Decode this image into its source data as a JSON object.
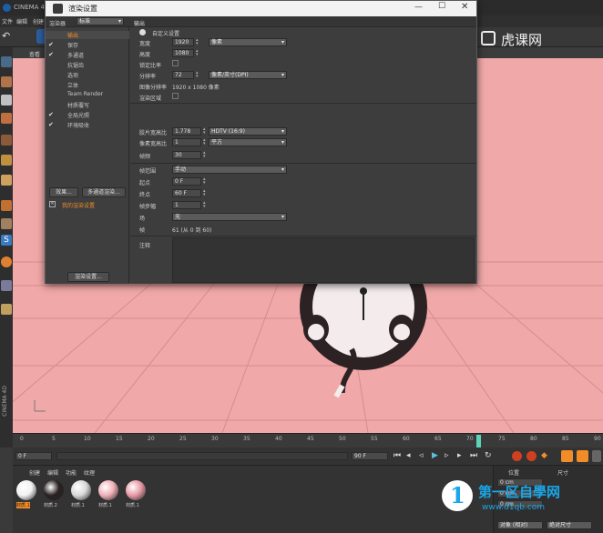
{
  "app": {
    "title": "CINEMA 4D",
    "menu": [
      "文件",
      "编辑",
      "创建"
    ],
    "viewport_menu": [
      "查看"
    ],
    "side_label": "CINEMA 4D"
  },
  "watermark_top": {
    "text": "虎课网"
  },
  "render_settings": {
    "window_title": "渲染设置",
    "renderer_label": "渲染器",
    "renderer_value": "标准",
    "panel_title": "输出",
    "nav": [
      {
        "label": "输出",
        "checked": false,
        "active": true
      },
      {
        "label": "保存",
        "checked": true,
        "active": false
      },
      {
        "label": "多通道",
        "checked": true,
        "active": false
      },
      {
        "label": "抗锯齿",
        "checked": false,
        "active": false
      },
      {
        "label": "选项",
        "checked": false,
        "active": false
      },
      {
        "label": "立体",
        "checked": false,
        "active": false
      },
      {
        "label": "Team Render",
        "checked": false,
        "active": false
      },
      {
        "label": "材质覆写",
        "checked": false,
        "active": false
      },
      {
        "label": "全局光照",
        "checked": true,
        "active": false
      },
      {
        "label": "环境吸收",
        "checked": true,
        "active": false
      }
    ],
    "effect_button": "效果...",
    "multipass_button": "多通道渲染...",
    "preset_item": "我的渲染设置",
    "render_settings_button": "渲染设置...",
    "preset_label": "自定义设置",
    "width_label": "宽度",
    "width_value": "1920",
    "width_unit": "像素",
    "height_label": "高度",
    "height_value": "1080",
    "lock_ratio_label": "锁定比率",
    "lock_ratio_value": "",
    "resolution_label": "分辨率",
    "resolution_value": "72",
    "resolution_unit": "像素/英寸(DPI)",
    "image_res_label": "图像分辨率",
    "image_res_value": "1920 x 1080 像素",
    "render_region_label": "渲染区域",
    "film_aspect_label": "胶片宽高比",
    "film_aspect_value": "1.778",
    "film_aspect_preset": "HDTV (16:9)",
    "pixel_aspect_label": "像素宽高比",
    "pixel_aspect_value": "1",
    "pixel_aspect_preset": "平方",
    "fps_label": "帧频",
    "fps_value": "30",
    "frame_range_label": "帧范围",
    "frame_range_value": "手动",
    "start_label": "起点",
    "start_value": "0 F",
    "end_label": "终点",
    "end_value": "60 F",
    "step_label": "帧步幅",
    "step_value": "1",
    "field_label": "场",
    "field_value": "无",
    "frames_label": "帧",
    "frames_value": "61 (从 0 到 60)",
    "notes_label": "注释"
  },
  "timeline": {
    "ticks": [
      "0",
      "5",
      "10",
      "15",
      "20",
      "25",
      "30",
      "35",
      "40",
      "45",
      "50",
      "55",
      "60",
      "65",
      "70",
      "75",
      "80",
      "85",
      "90"
    ],
    "current_frame": "0 F",
    "start_field": "0 F",
    "end_field": "90 F",
    "end_field2": "90 F"
  },
  "materials": {
    "tabs": [
      "创建",
      "编辑",
      "功能",
      "纹理"
    ],
    "items": [
      {
        "label": "材质.1",
        "color": "#f2f2f2"
      },
      {
        "label": "材质.2",
        "color": "#2a2222"
      },
      {
        "label": "材质.1",
        "color": "#d9d9d9"
      },
      {
        "label": "材质.1",
        "color": "#f0b0b8"
      },
      {
        "label": "材质.1",
        "color": "#e79aa4"
      }
    ]
  },
  "coords": {
    "headers": [
      "位置",
      "尺寸"
    ],
    "rows": [
      "0 cm",
      "0 cm",
      "0 cm"
    ],
    "mode": "对象 (相对)",
    "mode2": "绝对尺寸"
  },
  "watermark_bottom": {
    "title": "第一区自學网",
    "url": "www.d1qb.com"
  },
  "colors": {
    "viewport": "#f0a8a8",
    "accent": "#f28c28",
    "watermark_blue": "#1aa6e8"
  }
}
